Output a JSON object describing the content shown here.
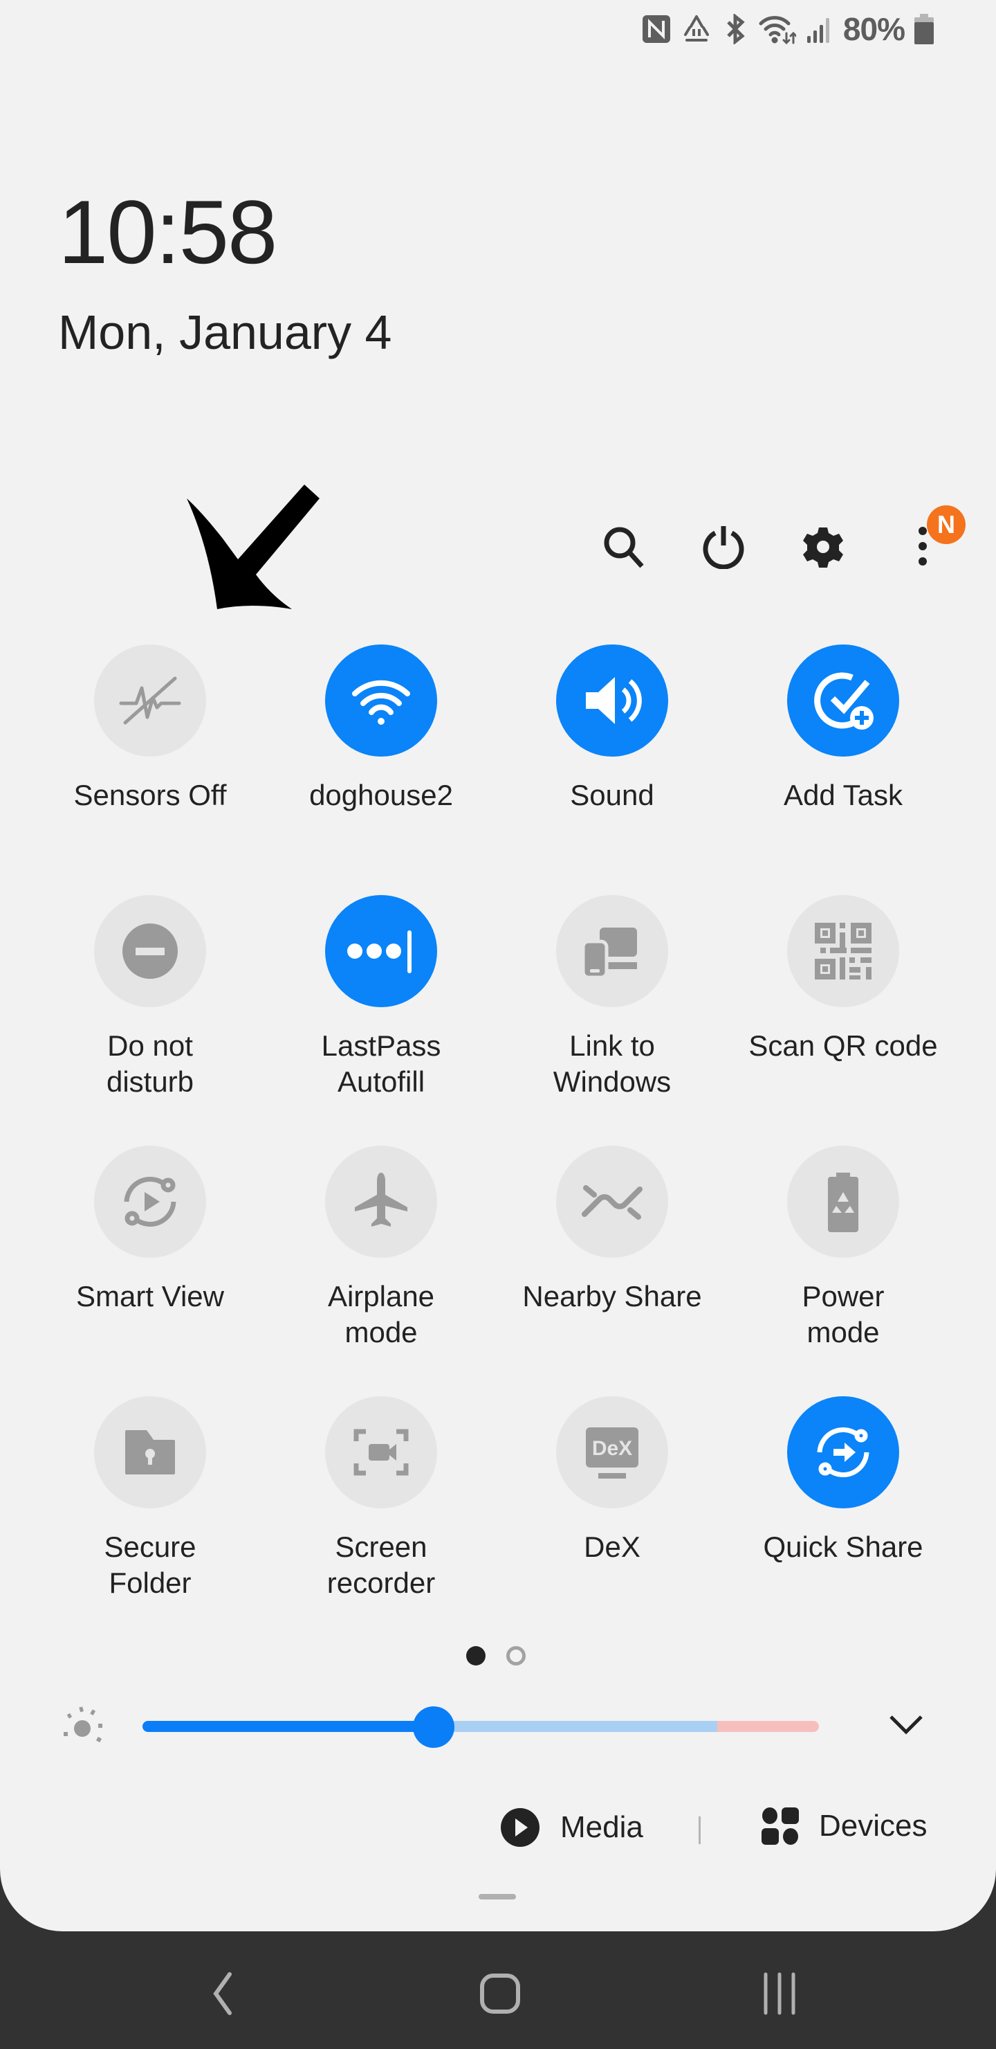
{
  "status_bar": {
    "icons": [
      "nfc-icon",
      "data-saver-icon",
      "bluetooth-icon",
      "wifi-icon",
      "cell-signal-icon",
      "battery-icon"
    ],
    "battery_percent": "80%"
  },
  "header": {
    "time": "10:58",
    "date": "Mon, January 4"
  },
  "annotation": {
    "arrow_target": "Sensors Off"
  },
  "toolbar": {
    "search": "search-icon",
    "power": "power-icon",
    "settings": "gear-icon",
    "more": "more-vertical-icon",
    "notification_badge": "N",
    "badge_color": "#f4731c"
  },
  "colors": {
    "accent": "#0a84f8",
    "tile_off": "#e5e5e5",
    "icon_off": "#9a9a9a",
    "panel_bg": "#f2f2f2",
    "nav_bg": "#323232"
  },
  "tiles": [
    {
      "label": "Sensors Off",
      "icon": "sensors-off-icon",
      "state": "off"
    },
    {
      "label": "doghouse2",
      "icon": "wifi-icon",
      "state": "on"
    },
    {
      "label": "Sound",
      "icon": "speaker-icon",
      "state": "on"
    },
    {
      "label": "Add Task",
      "icon": "add-task-icon",
      "state": "on"
    },
    {
      "label": "Do not\ndisturb",
      "icon": "do-not-disturb-icon",
      "state": "off"
    },
    {
      "label": "LastPass\nAutofill",
      "icon": "lastpass-icon",
      "state": "on"
    },
    {
      "label": "Link to\nWindows",
      "icon": "link-to-windows-icon",
      "state": "off"
    },
    {
      "label": "Scan QR code",
      "icon": "qr-code-icon",
      "state": "off"
    },
    {
      "label": "Smart View",
      "icon": "smart-view-icon",
      "state": "off"
    },
    {
      "label": "Airplane\nmode",
      "icon": "airplane-icon",
      "state": "off"
    },
    {
      "label": "Nearby Share",
      "icon": "nearby-share-icon",
      "state": "off"
    },
    {
      "label": "Power\nmode",
      "icon": "power-mode-icon",
      "state": "off"
    },
    {
      "label": "Secure\nFolder",
      "icon": "secure-folder-icon",
      "state": "off"
    },
    {
      "label": "Screen\nrecorder",
      "icon": "screen-recorder-icon",
      "state": "off"
    },
    {
      "label": "DeX",
      "icon": "dex-icon",
      "state": "off"
    },
    {
      "label": "Quick Share",
      "icon": "quick-share-icon",
      "state": "on"
    }
  ],
  "pagination": {
    "current_page": 1,
    "total_pages": 2
  },
  "brightness": {
    "level_fraction": 0.43,
    "extra_brightness_start_fraction": 0.85,
    "fill_color": "#0a7ef7",
    "track_color": "#a9cff3",
    "extra_color": "#f6bfbd"
  },
  "bottom_actions": {
    "media_label": "Media",
    "devices_label": "Devices"
  },
  "nav_bar": {
    "back": "back-icon",
    "home": "home-icon",
    "recents": "recents-icon"
  }
}
